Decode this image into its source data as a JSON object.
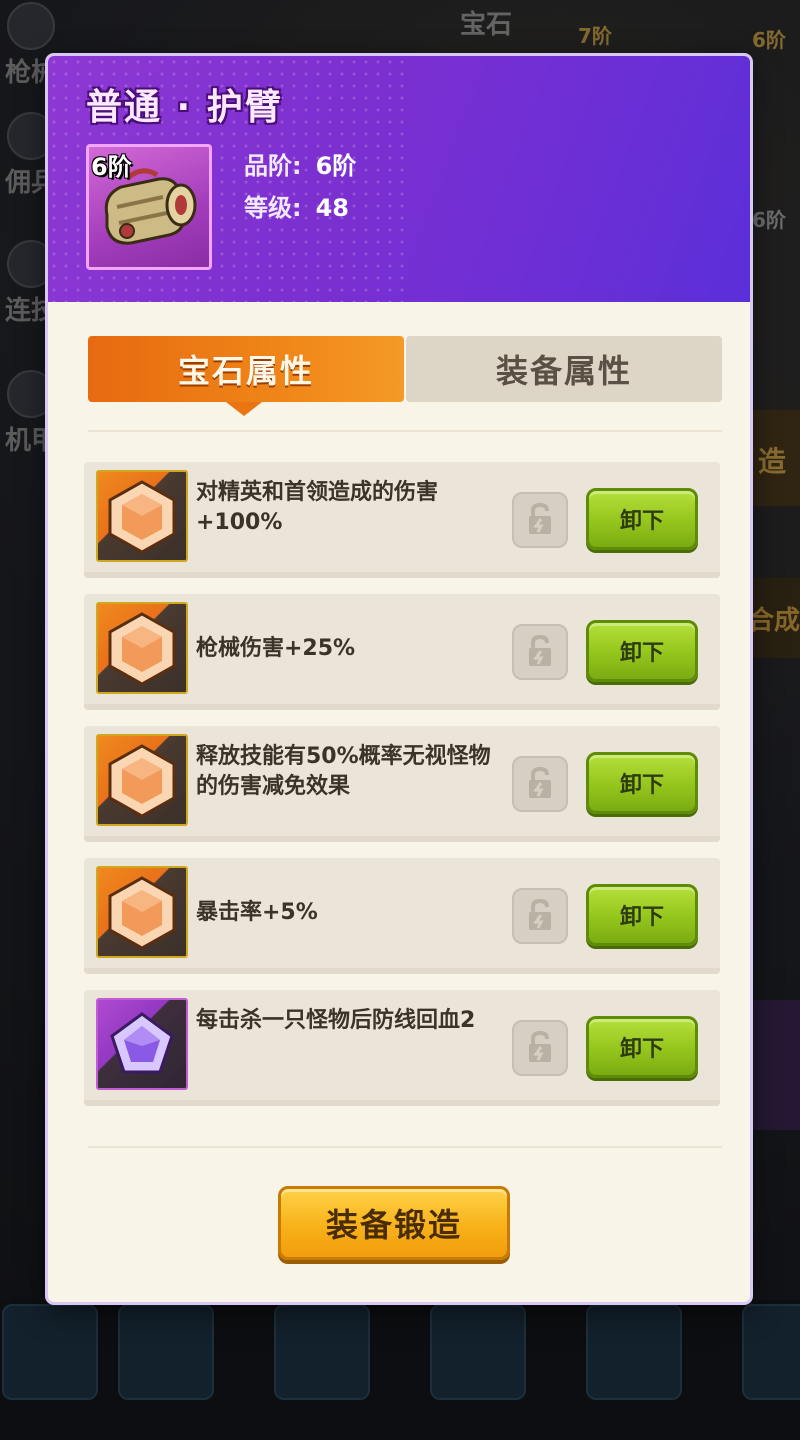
{
  "background": {
    "side_menu": [
      "枪械",
      "佣兵",
      "连技",
      "机甲"
    ],
    "top_tags": [
      "宝石",
      "7阶",
      "6阶",
      "6阶"
    ],
    "right_tags": [
      "造",
      "合成"
    ]
  },
  "item": {
    "title": "普通 · 护臂",
    "tier_badge": "6阶",
    "grade_label": "品阶:",
    "grade_value": "6阶",
    "level_label": "等级:",
    "level_value": "48"
  },
  "tabs": {
    "active": "宝石属性",
    "inactive": "装备属性"
  },
  "gems": [
    {
      "color": "orange",
      "text": "对精英和首领造成的伤害+100%",
      "unload_label": "卸下"
    },
    {
      "color": "orange",
      "text": "枪械伤害+25%",
      "unload_label": "卸下"
    },
    {
      "color": "orange",
      "text": "释放技能有50%概率无视怪物的伤害减免效果",
      "unload_label": "卸下"
    },
    {
      "color": "orange",
      "text": "暴击率+5%",
      "unload_label": "卸下"
    },
    {
      "color": "purple",
      "text": "每击杀一只怪物后防线回血2",
      "unload_label": "卸下"
    }
  ],
  "forge_label": "装备锻造",
  "colors": {
    "header_purple": "#7a2fd0",
    "tab_orange": "#ef8518",
    "unload_green": "#94c51c",
    "forge_yellow": "#f8b21a"
  }
}
